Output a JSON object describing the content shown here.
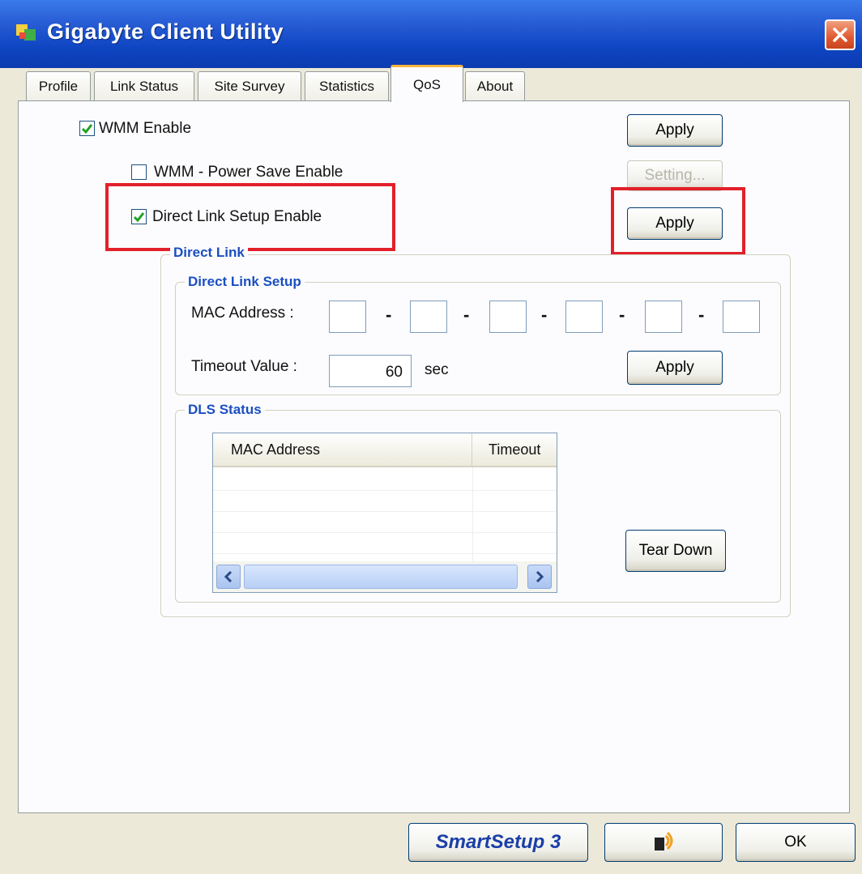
{
  "window": {
    "title": "Gigabyte Client Utility"
  },
  "tabs": [
    {
      "label": "Profile"
    },
    {
      "label": "Link Status"
    },
    {
      "label": "Site Survey"
    },
    {
      "label": "Statistics"
    },
    {
      "label": "QoS",
      "active": true
    },
    {
      "label": "About"
    }
  ],
  "qos": {
    "wmm_enable": {
      "label": "WMM Enable",
      "checked": true
    },
    "wmm_power_save": {
      "label": "WMM - Power Save Enable",
      "checked": false
    },
    "direct_link_setup_enable": {
      "label": "Direct Link Setup Enable",
      "checked": true
    },
    "apply_wmm_label": "Apply",
    "setting_label": "Setting...",
    "apply_dls_label": "Apply"
  },
  "direct_link": {
    "group_label": "Direct Link",
    "setup": {
      "group_label": "Direct Link Setup",
      "mac_label": "MAC Address :",
      "mac_octets": [
        "",
        "",
        "",
        "",
        "",
        ""
      ],
      "mac_separator": "-",
      "timeout_label": "Timeout Value :",
      "timeout_value": "60",
      "timeout_unit": "sec",
      "apply_label": "Apply"
    },
    "status": {
      "group_label": "DLS Status",
      "columns": [
        "MAC Address",
        "Timeout"
      ],
      "rows": [],
      "tear_down_label": "Tear Down"
    }
  },
  "bottom": {
    "smartsetup_label": "SmartSetup 3",
    "ok_label": "OK"
  },
  "colors": {
    "highlight": "#e2202a",
    "titlebar": "#0f45c2",
    "group_label": "#1b4fc0"
  }
}
